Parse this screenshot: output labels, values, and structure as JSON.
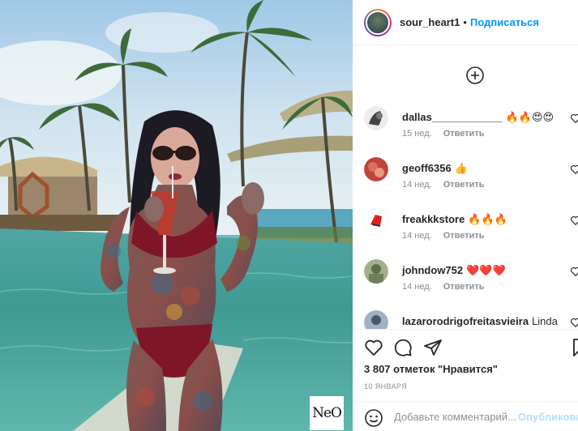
{
  "post": {
    "watermark": "NeO",
    "author": {
      "username": "sour_heart1",
      "separator": "•",
      "follow_label": "Подписаться"
    },
    "comments": [
      {
        "username": "dallas____________",
        "text": "🔥🔥😍😍",
        "age": "15 нед.",
        "reply_label": "Ответить",
        "avatar_color": "#e8e8e8"
      },
      {
        "username": "geoff6356",
        "text": "👍",
        "age": "14 нед.",
        "reply_label": "Ответить",
        "avatar_color": "#c0433d"
      },
      {
        "username": "freakkkstore",
        "text": "🔥🔥🔥",
        "age": "14 нед.",
        "reply_label": "Ответить",
        "avatar_color": "#ffffff"
      },
      {
        "username": "johndow752",
        "text": "❤️❤️❤️",
        "age": "14 нед.",
        "reply_label": "Ответить",
        "avatar_color": "#7e8f6c"
      },
      {
        "username": "lazarorodrigofreitasvieira",
        "text": "Linda",
        "age": "",
        "reply_label": "",
        "avatar_color": "#9fb1c4"
      }
    ],
    "likes_text": "3 807 отметок \"Нравится\"",
    "date_text": "10 ЯНВАРЯ",
    "add_comment": {
      "placeholder": "Добавьте комментарий...",
      "publish_label": "Опубликовать"
    },
    "icons": {
      "load_more": "plus-circle-icon",
      "like": "heart-icon",
      "comment": "comment-icon",
      "share": "paper-plane-icon",
      "save": "bookmark-icon",
      "emoji": "smile-icon",
      "comment_like": "heart-icon"
    },
    "colors": {
      "link_blue": "#0095f6",
      "muted_text": "#8e8e8e",
      "publish_disabled": "#b2dffc"
    }
  }
}
